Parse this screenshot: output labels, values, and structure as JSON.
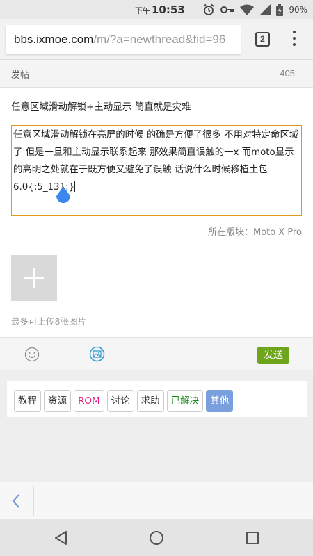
{
  "status_bar": {
    "ampm": "下午",
    "time": "10:53",
    "battery": "90%",
    "icons": [
      "alarm-icon",
      "key-icon",
      "wifi-icon",
      "signal-icon",
      "battery-icon"
    ]
  },
  "browser": {
    "url_host": "bbs.ixmoe.com",
    "url_rest": "/m/?a=newthread&fid=96",
    "tab_count": "2",
    "icons": [
      "menu-dots-icon"
    ]
  },
  "header": {
    "title": "发帖",
    "count": "405"
  },
  "post": {
    "subject": "任意区域滑动解锁+主动显示 简直就是灾难",
    "content": "任意区域滑动解锁在亮屏的时候 的确是方便了很多 不用对特定命区域了 但是一旦和主动显示联系起来 那效果简直误触的一x  而moto显示的高明之处就在于既方便又避免了误触 话说什么时候移植土包6.0{:5_131:}",
    "forum": "所在版块：Moto X Pro"
  },
  "upload": {
    "hint": "最多可上传8张图片"
  },
  "toolbar": {
    "send_label": "发送",
    "icons": [
      "emoji-icon",
      "image-icon"
    ]
  },
  "categories": [
    {
      "label": "教程",
      "color": "#333333"
    },
    {
      "label": "资源",
      "color": "#333333"
    },
    {
      "label": "ROM",
      "color": "#e0167a"
    },
    {
      "label": "讨论",
      "color": "#333333"
    },
    {
      "label": "求助",
      "color": "#333333"
    },
    {
      "label": "已解决",
      "color": "#1a8a1a"
    },
    {
      "label": "其他",
      "color": "#ffffff",
      "active": true
    }
  ],
  "colors": {
    "send": "#6fa51c",
    "active_category": "#7a9fde",
    "textarea_border": "#e29a1b",
    "cursor_handle": "#3d86f0"
  },
  "nav_icons": [
    "back-chevron-icon",
    "system-back-icon",
    "system-home-icon",
    "system-recents-icon"
  ]
}
